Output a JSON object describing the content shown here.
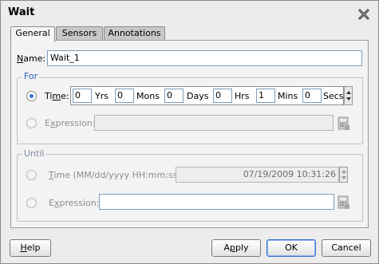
{
  "window": {
    "title": "Wait"
  },
  "tabs": [
    {
      "label": "General",
      "active": true
    },
    {
      "label": "Sensors",
      "active": false
    },
    {
      "label": "Annotations",
      "active": false
    }
  ],
  "name": {
    "label_prefix": "N",
    "label_rest": "ame:",
    "value": "Wait_1"
  },
  "for_group": {
    "legend": "For",
    "time": {
      "label_prefix": "Ti",
      "label_u": "m",
      "label_rest": "e:",
      "checked": true,
      "fields": [
        {
          "value": "0",
          "unit": "Yrs"
        },
        {
          "value": "0",
          "unit": "Mons"
        },
        {
          "value": "0",
          "unit": "Days"
        },
        {
          "value": "0",
          "unit": "Hrs"
        },
        {
          "value": "1",
          "unit": "Mins"
        },
        {
          "value": "0",
          "unit": "Secs"
        }
      ]
    },
    "expression": {
      "label_prefix": "E",
      "label_u": "x",
      "label_rest": "pression:",
      "value": ""
    }
  },
  "until_group": {
    "legend": "Until",
    "time": {
      "label_u": "T",
      "label_rest": "ime (MM/dd/yyyy HH:mm:ss):",
      "value": "07/19/2009 10:31:26"
    },
    "expression": {
      "label_prefix": "E",
      "label_u": "x",
      "label_rest": "pression:",
      "value": ""
    }
  },
  "buttons": {
    "help": {
      "u": "H",
      "rest": "elp"
    },
    "apply": {
      "prefix": "A",
      "u": "p",
      "rest": "ply"
    },
    "ok": "OK",
    "cancel": "Cancel"
  },
  "colors": {
    "accent": "#3a6fd0",
    "legend": "#2a5db0",
    "panel_bg": "#f3f3f3"
  },
  "icons": {
    "close": "close-icon",
    "expression_builder": "expression-builder-icon"
  }
}
